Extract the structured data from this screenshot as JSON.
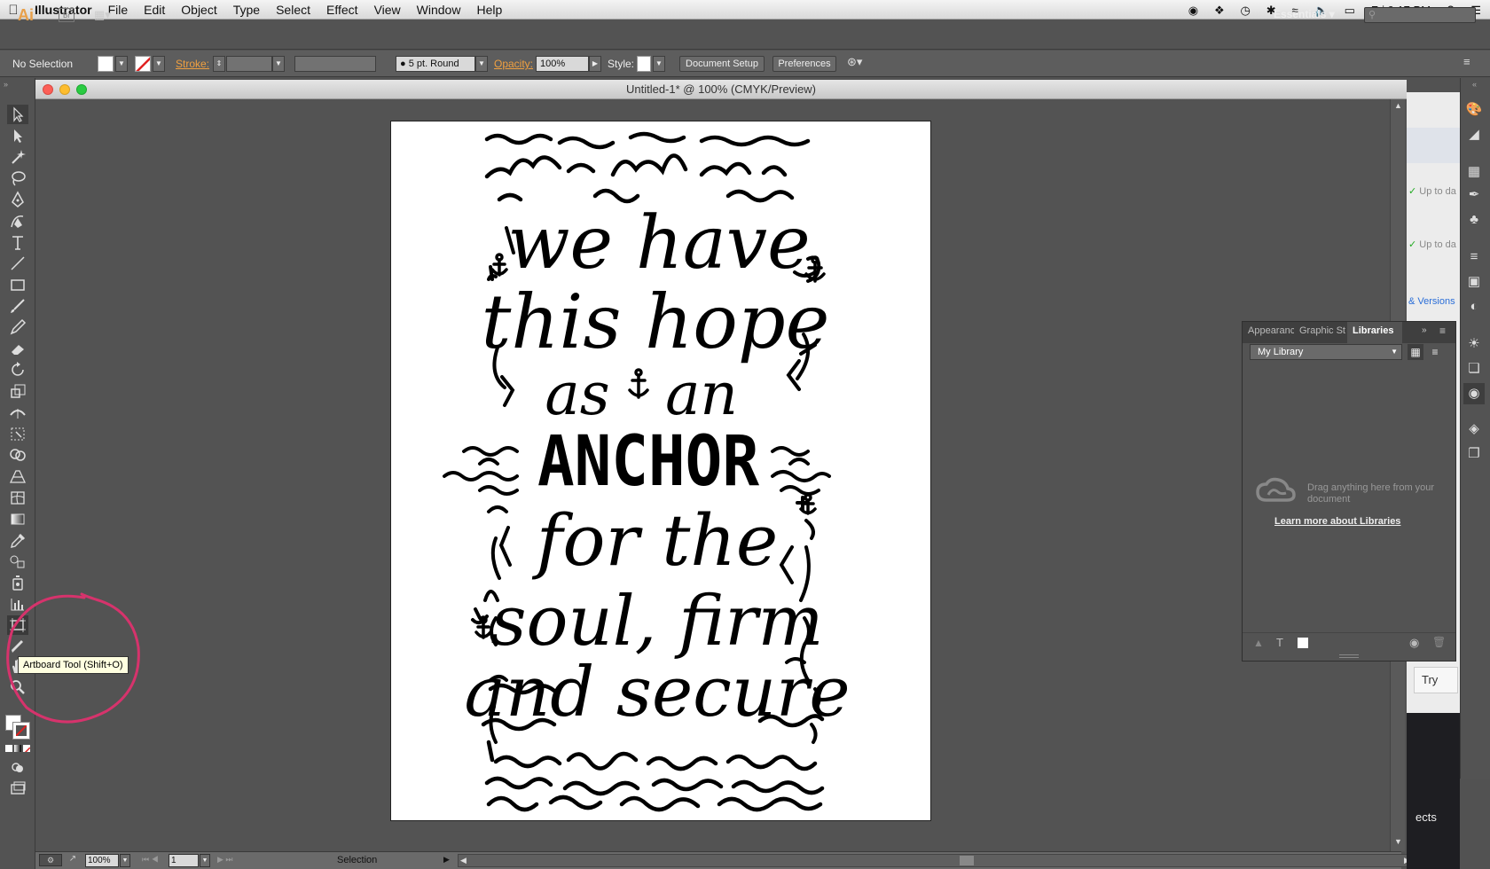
{
  "menubar": {
    "app_name": "Illustrator",
    "items": [
      "File",
      "Edit",
      "Object",
      "Type",
      "Select",
      "Effect",
      "View",
      "Window",
      "Help"
    ],
    "clock": "Fri 9:17 PM"
  },
  "appbar": {
    "logo": "Ai",
    "bridge": "Br",
    "workspace": "Essentials"
  },
  "controlbar": {
    "selection_status": "No Selection",
    "stroke_label": "Stroke:",
    "brush": "5 pt. Round",
    "opacity_label": "Opacity:",
    "opacity_value": "100%",
    "style_label": "Style:",
    "document_setup": "Document Setup",
    "preferences": "Preferences"
  },
  "document": {
    "title": "Untitled-1* @ 100% (CMYK/Preview)"
  },
  "tooltip": "Artboard Tool (Shift+O)",
  "artwork": {
    "lines": [
      "we have",
      "this hope",
      "as",
      "an",
      "ANCHOR",
      "for the",
      "soul, firm",
      "and secure"
    ]
  },
  "statusbar": {
    "zoom": "100%",
    "artboard": "1",
    "tool": "Selection"
  },
  "behind_window": {
    "status_1": "Up to da",
    "status_2": "Up to da",
    "versions": "& Versions",
    "try_button": "Try",
    "bottom_text": "ects"
  },
  "libraries_panel": {
    "tabs": [
      "Appearanc",
      "Graphic St",
      "Libraries"
    ],
    "library_name": "My Library",
    "empty_message": "Drag anything here from your document",
    "learn_more": "Learn more about Libraries"
  },
  "colors": {
    "accent_orange": "#f0a040",
    "highlight_circle": "#d6336c"
  }
}
